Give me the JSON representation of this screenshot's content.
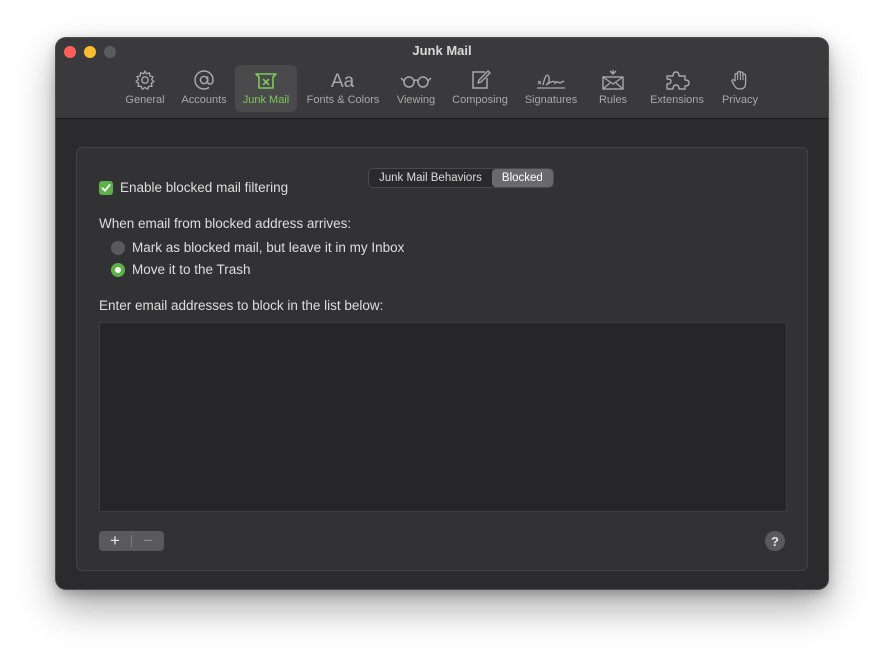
{
  "window": {
    "title": "Junk Mail"
  },
  "toolbar": {
    "items": [
      {
        "label": "General",
        "icon": "gear-icon"
      },
      {
        "label": "Accounts",
        "icon": "at-icon"
      },
      {
        "label": "Junk Mail",
        "icon": "junk-tray-icon",
        "active": true
      },
      {
        "label": "Fonts & Colors",
        "icon": "font-aa-icon"
      },
      {
        "label": "Viewing",
        "icon": "glasses-icon"
      },
      {
        "label": "Composing",
        "icon": "compose-icon"
      },
      {
        "label": "Signatures",
        "icon": "signature-icon"
      },
      {
        "label": "Rules",
        "icon": "rules-envelope-icon"
      },
      {
        "label": "Extensions",
        "icon": "puzzle-icon"
      },
      {
        "label": "Privacy",
        "icon": "hand-icon"
      }
    ]
  },
  "tabs": {
    "items": [
      "Junk Mail Behaviors",
      "Blocked"
    ],
    "selected": "Blocked"
  },
  "blocked": {
    "enable_label": "Enable blocked mail filtering",
    "enable_checked": true,
    "arrives_label": "When email from blocked address arrives:",
    "options": [
      {
        "label": "Mark as blocked mail, but leave it in my Inbox",
        "selected": false
      },
      {
        "label": "Move it to the Trash",
        "selected": true
      }
    ],
    "list_label": "Enter email addresses to block in the list below:",
    "addresses": [],
    "add_symbol": "+",
    "remove_symbol": "−",
    "help_symbol": "?"
  },
  "colors": {
    "accent": "#5db04a",
    "active_label": "#7fc75a",
    "window_bg": "#2e2e30"
  }
}
